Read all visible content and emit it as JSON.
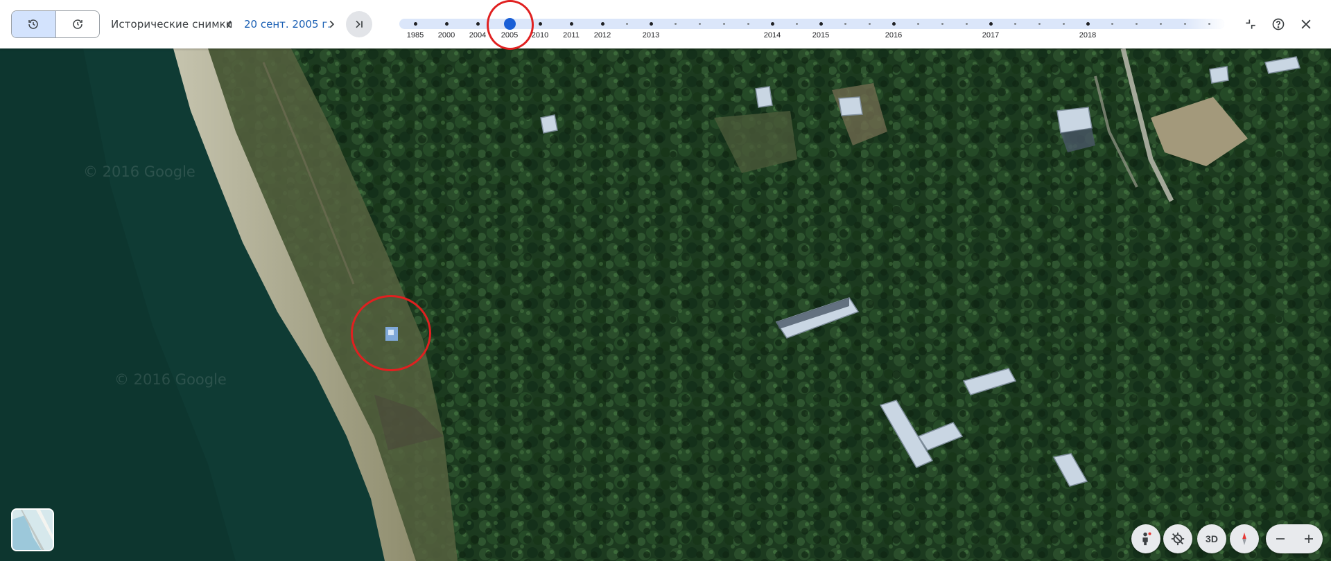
{
  "toolbar": {
    "history_label": "Исторические снимки",
    "current_date": "20 сент. 2005 г.",
    "icons": {
      "history_mode": "history-icon",
      "restore_mode": "restore-icon",
      "prev": "chevron-left-icon",
      "next": "chevron-right-icon",
      "latest": "skip-to-latest-icon",
      "collapse": "collapse-icon",
      "help": "help-icon",
      "close": "close-icon"
    }
  },
  "timeline": {
    "selected_year": "2005",
    "year_labels": [
      "1985",
      "2000",
      "2004",
      "2005",
      "2010",
      "2011",
      "2012",
      "2013",
      "2014",
      "2015",
      "2016",
      "2017",
      "2018"
    ]
  },
  "map": {
    "watermark_1": "© 2016 Google",
    "watermark_2": "© 2016 Google"
  },
  "controls": {
    "three_d_label": "3D",
    "icons": {
      "pegman": "pegman-icon",
      "location": "location-off-icon",
      "compass": "compass-icon",
      "zoom_out": "minus-icon",
      "zoom_in": "plus-icon",
      "layers": "map-layer-thumbnail"
    }
  },
  "colors": {
    "accent": "#1a5fd6",
    "annotation": "#e02020",
    "water": "#0f3b34",
    "forest": "#1e3d21"
  }
}
